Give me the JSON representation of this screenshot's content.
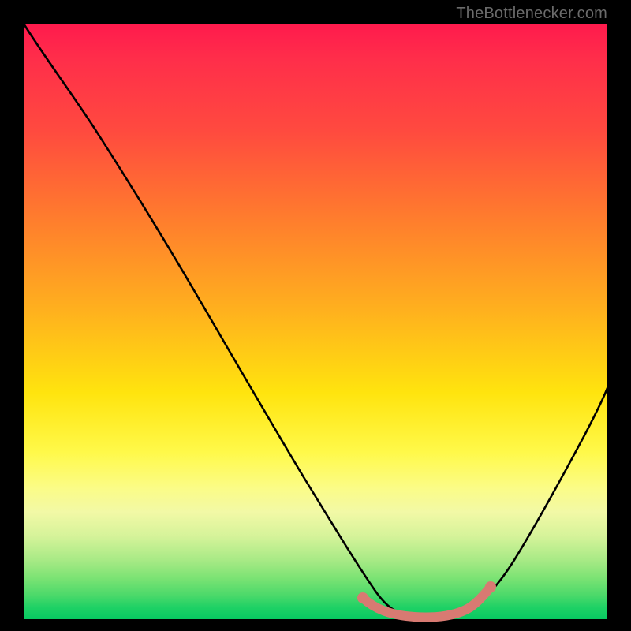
{
  "credit": "TheBottlenecker.com",
  "colors": {
    "page_bg": "#000000",
    "gradient_top": "#ff1a4d",
    "gradient_bottom": "#07c962",
    "curve": "#000000",
    "highlight": "#d87a72"
  },
  "chart_data": {
    "type": "line",
    "title": "",
    "xlabel": "",
    "ylabel": "",
    "xlim": [
      0,
      100
    ],
    "ylim": [
      0,
      100
    ],
    "grid": false,
    "series": [
      {
        "name": "bottleneck-curve",
        "x": [
          0,
          5,
          10,
          15,
          20,
          25,
          30,
          35,
          40,
          45,
          50,
          55,
          57,
          60,
          63,
          66,
          70,
          73,
          78,
          82,
          86,
          90,
          94,
          100
        ],
        "y": [
          100,
          94,
          87,
          79,
          71,
          63,
          55,
          46,
          38,
          30,
          22,
          14,
          10,
          6,
          3,
          1,
          0,
          0,
          1,
          3,
          8,
          15,
          24,
          40
        ]
      },
      {
        "name": "optimal-range-highlight",
        "x": [
          57,
          60,
          63,
          66,
          70,
          73,
          76,
          78
        ],
        "y": [
          4.5,
          2.5,
          1.5,
          1,
          1,
          1.5,
          2.5,
          4
        ]
      }
    ],
    "annotations": []
  }
}
